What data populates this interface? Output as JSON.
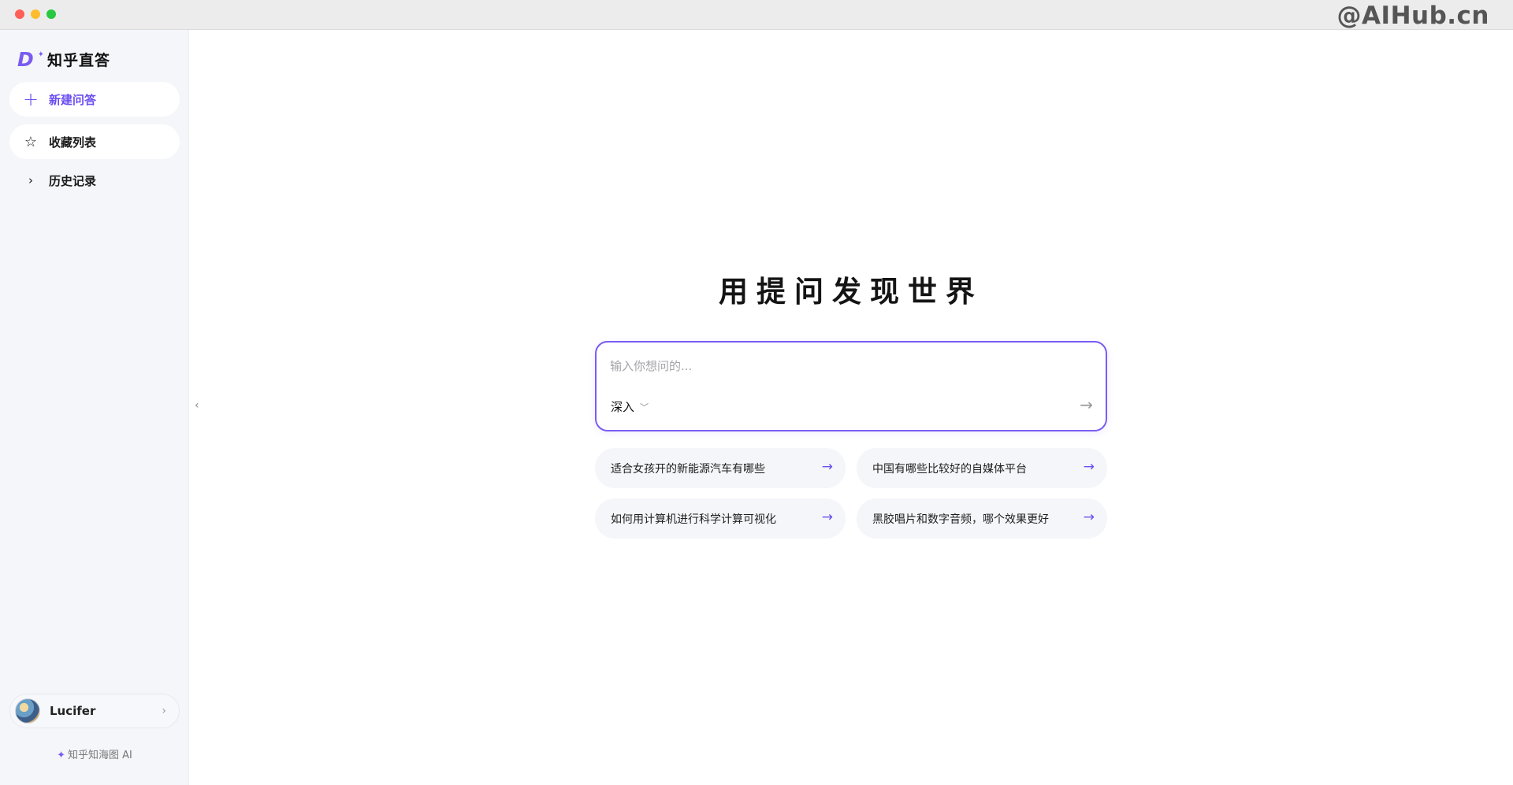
{
  "watermark": "@AIHub.cn",
  "sidebar": {
    "logo_text": "知乎直答",
    "new_question": "新建问答",
    "favorites": "收藏列表",
    "history": "历史记录",
    "user_name": "Lucifer",
    "footer": "知乎知海图 AI"
  },
  "main": {
    "hero": "用提问发现世界",
    "input_placeholder": "输入你想问的...",
    "mode": "深入",
    "suggestions": [
      "适合女孩开的新能源汽车有哪些",
      "中国有哪些比较好的自媒体平台",
      "如何用计算机进行科学计算可视化",
      "黑胶唱片和数字音频，哪个效果更好"
    ]
  },
  "colors": {
    "accent": "#6b4ff0",
    "sidebar_bg": "#f5f6fa"
  },
  "icons": [
    "plus-icon",
    "star-icon",
    "chevron-right-icon",
    "arrow-right-icon",
    "chevron-down-icon",
    "sparkle-icon"
  ]
}
